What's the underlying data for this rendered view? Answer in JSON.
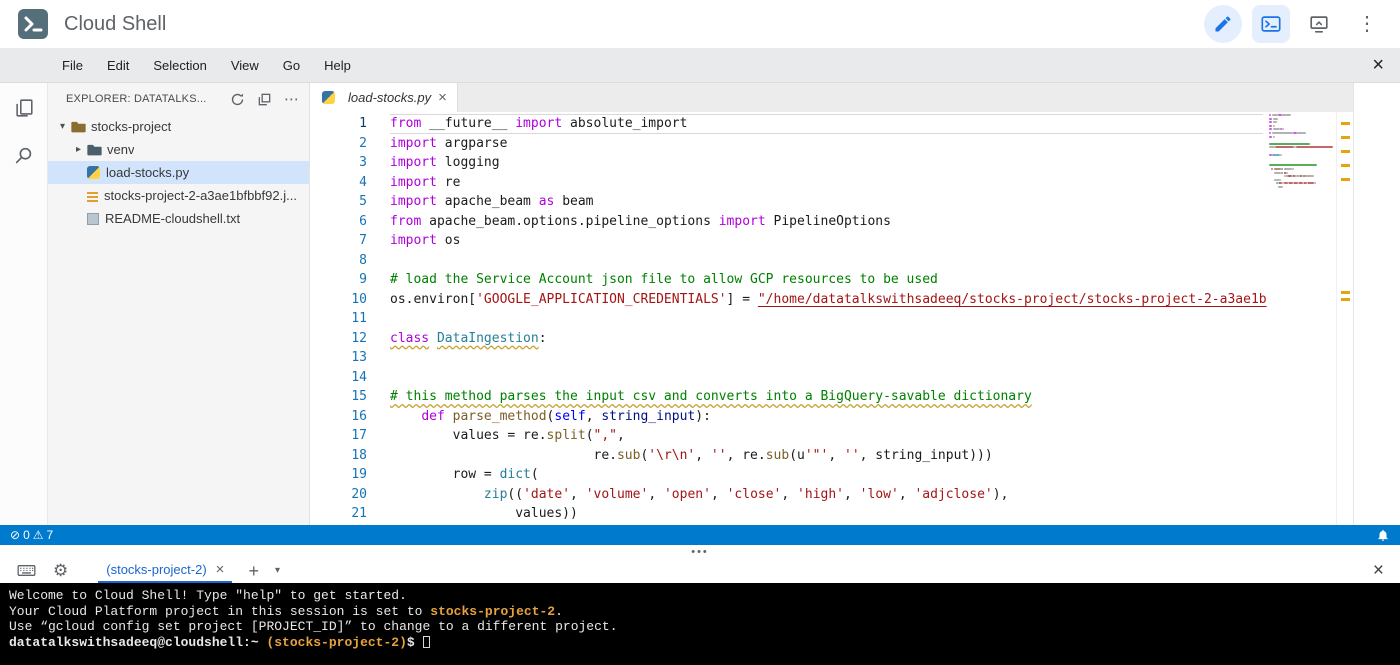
{
  "header": {
    "title": "Cloud Shell"
  },
  "menubar": {
    "items": [
      "File",
      "Edit",
      "Selection",
      "View",
      "Go",
      "Help"
    ]
  },
  "explorer": {
    "title": "EXPLORER: DATATALKS...",
    "tree": [
      {
        "label": "stocks-project",
        "icon": "folder-open",
        "arrow": "▾",
        "depth": 0,
        "selected": false
      },
      {
        "label": "venv",
        "icon": "folder",
        "arrow": "▸",
        "depth": 1,
        "selected": false
      },
      {
        "label": "load-stocks.py",
        "icon": "python",
        "arrow": "",
        "depth": 1,
        "selected": true
      },
      {
        "label": "stocks-project-2-a3ae1bfbbf92.j...",
        "icon": "json",
        "arrow": "",
        "depth": 1,
        "selected": false
      },
      {
        "label": "README-cloudshell.txt",
        "icon": "text",
        "arrow": "",
        "depth": 1,
        "selected": false
      }
    ]
  },
  "editor": {
    "tab": {
      "label": "load-stocks.py"
    },
    "code": [
      {
        "n": 1,
        "current": true,
        "tokens": [
          {
            "t": "from",
            "c": "kw"
          },
          {
            "t": " __future__ "
          },
          {
            "t": "import",
            "c": "kw"
          },
          {
            "t": " absolute_import"
          }
        ]
      },
      {
        "n": 2,
        "tokens": [
          {
            "t": "import",
            "c": "kw"
          },
          {
            "t": " argparse"
          }
        ]
      },
      {
        "n": 3,
        "tokens": [
          {
            "t": "import",
            "c": "kw"
          },
          {
            "t": " logging"
          }
        ]
      },
      {
        "n": 4,
        "tokens": [
          {
            "t": "import",
            "c": "kw"
          },
          {
            "t": " re"
          }
        ]
      },
      {
        "n": 5,
        "tokens": [
          {
            "t": "import",
            "c": "kw"
          },
          {
            "t": " apache_beam "
          },
          {
            "t": "as",
            "c": "kw"
          },
          {
            "t": " beam"
          }
        ]
      },
      {
        "n": 6,
        "tokens": [
          {
            "t": "from",
            "c": "kw"
          },
          {
            "t": " apache_beam.options.pipeline_options "
          },
          {
            "t": "import",
            "c": "kw"
          },
          {
            "t": " PipelineOptions"
          }
        ]
      },
      {
        "n": 7,
        "tokens": [
          {
            "t": "import",
            "c": "kw"
          },
          {
            "t": " os"
          }
        ]
      },
      {
        "n": 8,
        "tokens": []
      },
      {
        "n": 9,
        "tokens": [
          {
            "t": "# load the Service Account json file to allow GCP resources to be used",
            "c": "cm"
          }
        ]
      },
      {
        "n": 10,
        "tokens": [
          {
            "t": "os.environ["
          },
          {
            "t": "'GOOGLE_APPLICATION_CREDENTIALS'",
            "c": "str"
          },
          {
            "t": "] = "
          },
          {
            "t": "\"/home/datatalkswithsadeeq/stocks-project/stocks-project-2-a3ae1b",
            "c": "str u"
          }
        ]
      },
      {
        "n": 11,
        "tokens": []
      },
      {
        "n": 12,
        "tokens": [
          {
            "t": "class",
            "c": "kw wavy"
          },
          {
            "t": " "
          },
          {
            "t": "DataIngestion",
            "c": "cls wavy"
          },
          {
            "t": ":"
          }
        ]
      },
      {
        "n": 13,
        "tokens": []
      },
      {
        "n": 14,
        "tokens": []
      },
      {
        "n": 15,
        "tokens": [
          {
            "t": "# this method parses the input csv and converts into a BigQuery-savable dictionary",
            "c": "cm wavy"
          }
        ]
      },
      {
        "n": 16,
        "tokens": [
          {
            "t": "    "
          },
          {
            "t": "def",
            "c": "kw"
          },
          {
            "t": " "
          },
          {
            "t": "parse_method",
            "c": "fn"
          },
          {
            "t": "("
          },
          {
            "t": "self",
            "c": "self"
          },
          {
            "t": ", "
          },
          {
            "t": "string_input",
            "c": "param"
          },
          {
            "t": "):"
          }
        ]
      },
      {
        "n": 17,
        "tokens": [
          {
            "t": "        values = re."
          },
          {
            "t": "split",
            "c": "fn"
          },
          {
            "t": "("
          },
          {
            "t": "\",\"",
            "c": "str"
          },
          {
            "t": ","
          }
        ]
      },
      {
        "n": 18,
        "tokens": [
          {
            "t": "                          re."
          },
          {
            "t": "sub",
            "c": "fn"
          },
          {
            "t": "("
          },
          {
            "t": "'\\r\\n'",
            "c": "str"
          },
          {
            "t": ", "
          },
          {
            "t": "''",
            "c": "str"
          },
          {
            "t": ", re."
          },
          {
            "t": "sub",
            "c": "fn"
          },
          {
            "t": "(u"
          },
          {
            "t": "'\"'",
            "c": "str"
          },
          {
            "t": ", "
          },
          {
            "t": "''",
            "c": "str"
          },
          {
            "t": ", string_input)))"
          }
        ]
      },
      {
        "n": 19,
        "tokens": [
          {
            "t": "        row = "
          },
          {
            "t": "dict",
            "c": "blt"
          },
          {
            "t": "("
          }
        ]
      },
      {
        "n": 20,
        "tokens": [
          {
            "t": "            "
          },
          {
            "t": "zip",
            "c": "blt"
          },
          {
            "t": "(("
          },
          {
            "t": "'date'",
            "c": "str"
          },
          {
            "t": ", "
          },
          {
            "t": "'volume'",
            "c": "str"
          },
          {
            "t": ", "
          },
          {
            "t": "'open'",
            "c": "str"
          },
          {
            "t": ", "
          },
          {
            "t": "'close'",
            "c": "str"
          },
          {
            "t": ", "
          },
          {
            "t": "'high'",
            "c": "str"
          },
          {
            "t": ", "
          },
          {
            "t": "'low'",
            "c": "str"
          },
          {
            "t": ", "
          },
          {
            "t": "'adjclose'",
            "c": "str"
          },
          {
            "t": "),"
          }
        ]
      },
      {
        "n": 21,
        "tokens": [
          {
            "t": "                values))"
          }
        ]
      }
    ]
  },
  "statusbar": {
    "errors_count": "0",
    "warnings_count": "7"
  },
  "panel": {
    "tab_label": "(stocks-project-2)",
    "terminal_lines": [
      [
        {
          "t": "Welcome to Cloud Shell! Type \"help\" to get started."
        }
      ],
      [
        {
          "t": "Your Cloud Platform project in this session is set to "
        },
        {
          "t": "stocks-project-2",
          "c": "y"
        },
        {
          "t": "."
        }
      ],
      [
        {
          "t": "Use “gcloud config set project [PROJECT_ID]” to change to a different project."
        }
      ],
      [
        {
          "t": "datatalkswithsadeeq@cloudshell:~ ",
          "c": "w"
        },
        {
          "t": "(stocks-project-2)",
          "c": "y"
        },
        {
          "t": "$ ",
          "c": "w"
        },
        {
          "t": "",
          "c": "cursor"
        }
      ]
    ]
  },
  "icons": {
    "close": "×",
    "more_vert": "⋮",
    "more_horiz": "⋯",
    "drag_handle": "•••",
    "gear": "⚙",
    "errors": "⊘",
    "warnings": "⚠",
    "plus": "+",
    "caret_down": "▾"
  },
  "colors": {
    "accent_blue": "#1a73e8",
    "statusbar_blue": "#007acc",
    "selection_blue": "#d2e3fc",
    "terminal_bg": "#000000",
    "terminal_highlight": "#e6a23c",
    "keyword": "#af00db",
    "string": "#a31515",
    "comment": "#008000",
    "warning_marker": "#e5a50a"
  }
}
